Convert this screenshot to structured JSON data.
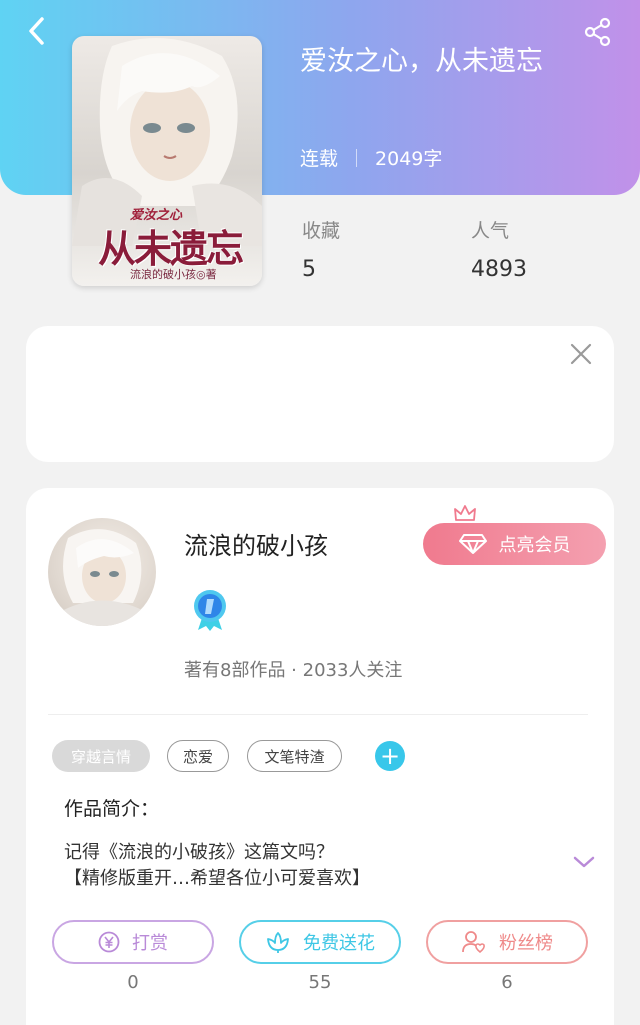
{
  "book": {
    "title": "爱汝之心，从未遗忘",
    "status": "连载",
    "word_count": "2049字",
    "cover": {
      "subtitle": "爱汝之心",
      "title": "从未遗忘",
      "author": "流浪的破小孩◎著"
    }
  },
  "stats": {
    "favorites_label": "收藏",
    "favorites_value": "5",
    "popularity_label": "人气",
    "popularity_value": "4893"
  },
  "author": {
    "name": "流浪的破小孩",
    "stats": "著有8部作品 · 2033人关注",
    "vip_button": "点亮会员"
  },
  "tags": [
    "穿越言情",
    "恋爱",
    "文笔特渣"
  ],
  "intro": {
    "label": "作品简介：",
    "line1": "记得《流浪的小破孩》这篇文吗？",
    "line2": "【精修版重开…希望各位小可爱喜欢】"
  },
  "actions": [
    {
      "label": "打赏",
      "count": "0",
      "icon": "yen-coin-icon",
      "color": "#b98ad8"
    },
    {
      "label": "免费送花",
      "count": "55",
      "icon": "flower-icon",
      "color": "#3ec7e5"
    },
    {
      "label": "粉丝榜",
      "count": "6",
      "icon": "fan-rank-icon",
      "color": "#ef8a8a"
    }
  ],
  "colors": {
    "header_gradient_start": "#5fd3f3",
    "header_gradient_end": "#c191e9",
    "accent_blue": "#38c7ea",
    "vip_pink": "#f07a8e"
  }
}
